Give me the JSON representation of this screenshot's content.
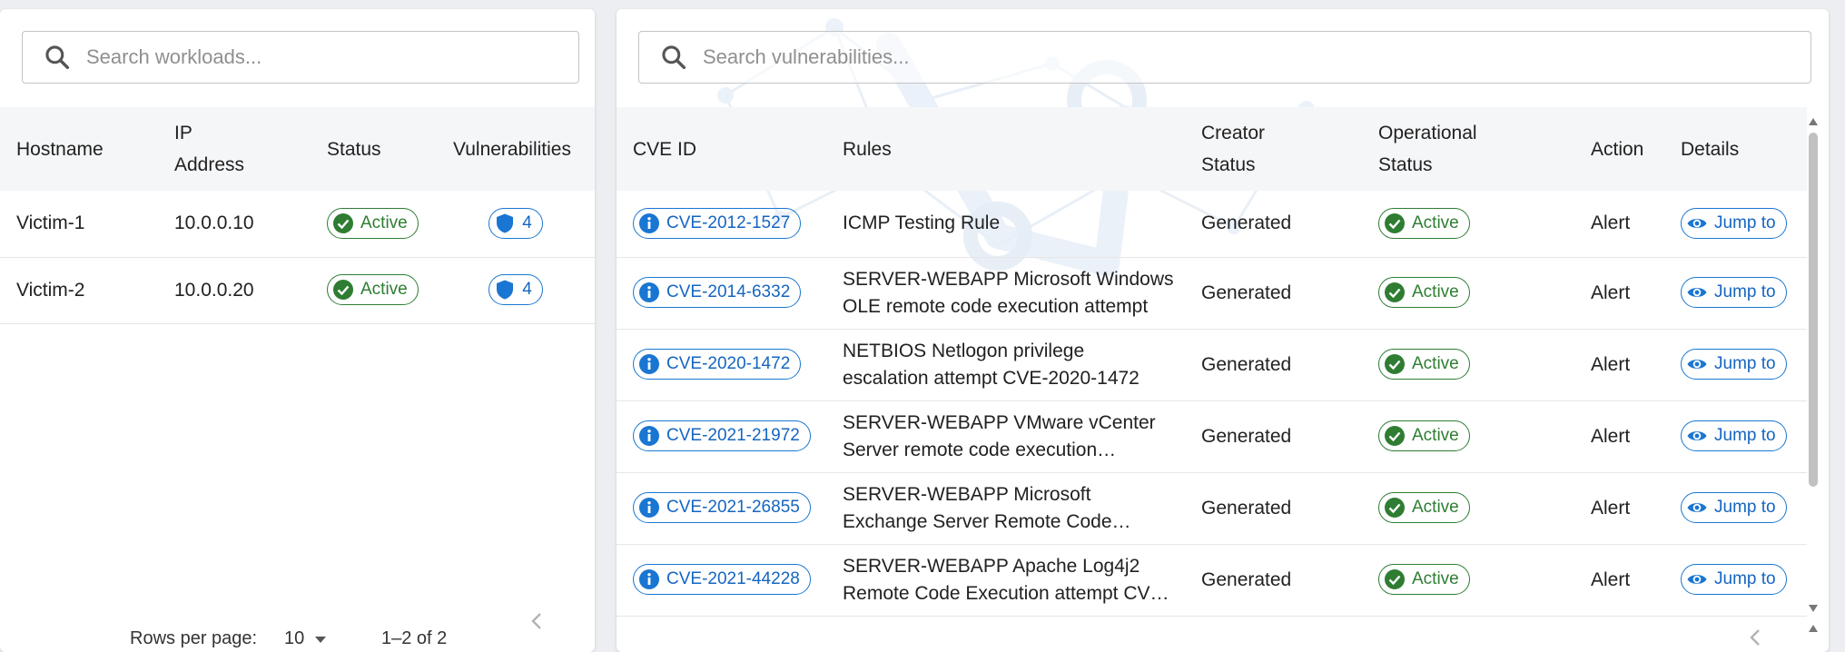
{
  "workloads": {
    "search": {
      "placeholder": "Search workloads..."
    },
    "columns": [
      "Hostname",
      "IP Address",
      "Status",
      "Vulnerabilities"
    ],
    "column_lines": [
      [
        "Hostname"
      ],
      [
        "IP",
        "Address"
      ],
      [
        "Status"
      ],
      [
        "Vulnerabilities"
      ]
    ],
    "rows": [
      {
        "hostname": "Victim-1",
        "ip": "10.0.0.10",
        "status": "Active",
        "vulnerabilities": "4"
      },
      {
        "hostname": "Victim-2",
        "ip": "10.0.0.20",
        "status": "Active",
        "vulnerabilities": "4"
      }
    ],
    "pagination": {
      "rows_per_page_label": "Rows per page:",
      "rows_per_page": "10",
      "range": "1–2 of 2"
    }
  },
  "vulnerabilities": {
    "search": {
      "placeholder": "Search vulnerabilities..."
    },
    "columns": [
      "CVE ID",
      "Rules",
      "Creator Status",
      "Operational Status",
      "Action",
      "Details"
    ],
    "column_lines": [
      [
        "CVE ID"
      ],
      [
        "Rules"
      ],
      [
        "Creator",
        "Status"
      ],
      [
        "Operational",
        "Status"
      ],
      [
        "Action"
      ],
      [
        "Details"
      ]
    ],
    "rows": [
      {
        "cve": "CVE-2012-1527",
        "rule_lines": [
          "ICMP Testing Rule"
        ],
        "creator_status": "Generated",
        "operational_status": "Active",
        "action": "Alert",
        "details": "Jump to"
      },
      {
        "cve": "CVE-2014-6332",
        "rule_lines": [
          "SERVER-WEBAPP Microsoft Windows",
          "OLE remote code execution attempt"
        ],
        "creator_status": "Generated",
        "operational_status": "Active",
        "action": "Alert",
        "details": "Jump to"
      },
      {
        "cve": "CVE-2020-1472",
        "rule_lines": [
          "NETBIOS Netlogon privilege",
          "escalation attempt CVE-2020-1472"
        ],
        "creator_status": "Generated",
        "operational_status": "Active",
        "action": "Alert",
        "details": "Jump to"
      },
      {
        "cve": "CVE-2021-21972",
        "rule_lines": [
          "SERVER-WEBAPP VMware vCenter",
          "Server remote code execution…"
        ],
        "creator_status": "Generated",
        "operational_status": "Active",
        "action": "Alert",
        "details": "Jump to"
      },
      {
        "cve": "CVE-2021-26855",
        "rule_lines": [
          "SERVER-WEBAPP Microsoft",
          "Exchange Server Remote Code…"
        ],
        "creator_status": "Generated",
        "operational_status": "Active",
        "action": "Alert",
        "details": "Jump to"
      },
      {
        "cve": "CVE-2021-44228",
        "rule_lines": [
          "SERVER-WEBAPP Apache Log4j2",
          "Remote Code Execution attempt CV…"
        ],
        "creator_status": "Generated",
        "operational_status": "Active",
        "action": "Alert",
        "details": "Jump to"
      }
    ]
  },
  "icons": {
    "search": "search-icon",
    "status": "check-circle-icon",
    "vulnerability": "shield-icon",
    "cve": "info-icon",
    "details": "eye-icon",
    "prev_page": "chevron-left-icon",
    "dropdown": "caret-down-icon"
  },
  "colors": {
    "active_green": "#2e7d32",
    "link_blue": "#1976d2",
    "header_bg": "#f5f6f8"
  }
}
